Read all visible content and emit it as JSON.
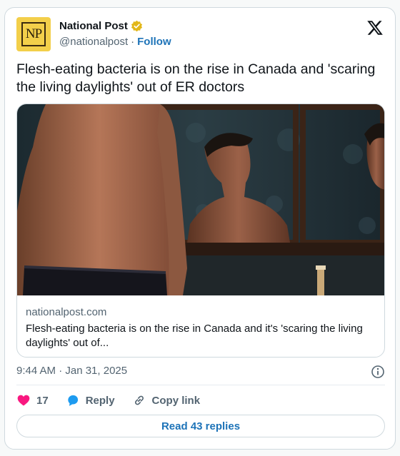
{
  "account": {
    "avatar_text": "NP",
    "display_name": "National Post",
    "handle": "@nationalpost",
    "separator": "·",
    "follow_label": "Follow"
  },
  "tweet": {
    "text": "Flesh-eating bacteria is on the rise in Canada and 'scaring the living daylights' out of ER doctors"
  },
  "link_card": {
    "domain": "nationalpost.com",
    "title": "Flesh-eating bacteria is on the rise in Canada and it's 'scaring the living daylights' out of..."
  },
  "meta": {
    "timestamp": "9:44 AM · Jan 31, 2025"
  },
  "actions": {
    "like_count": "17",
    "reply_label": "Reply",
    "copy_link_label": "Copy link"
  },
  "replies": {
    "label": "Read 43 replies"
  },
  "colors": {
    "accent": "#1d73b8",
    "like": "#f91880",
    "verified_gold": "#e2b719",
    "avatar_bg": "#f3cf4a"
  },
  "icons": [
    "verified-badge-icon",
    "x-logo-icon",
    "info-icon",
    "heart-icon",
    "reply-bubble-icon",
    "copy-link-icon"
  ]
}
